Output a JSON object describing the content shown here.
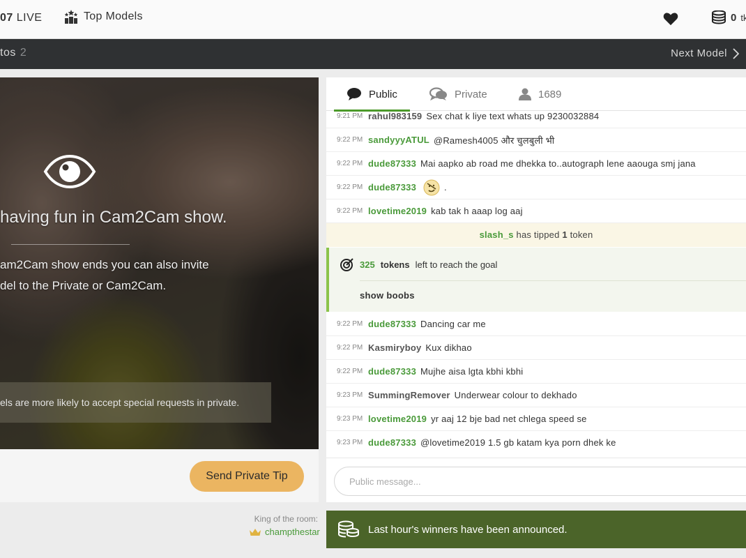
{
  "header": {
    "live_count_partial": "07",
    "live_label": "LIVE",
    "top_models_label": "Top Models",
    "token_count": "0",
    "token_label_partial": "tk"
  },
  "subbar": {
    "photos_label_partial": "tos",
    "photos_count": "2",
    "next_model_label": "Next Model"
  },
  "video": {
    "headline": "having fun in Cam2Cam show.",
    "line1": "am2Cam show ends you can also invite",
    "line2": "del to the Private or Cam2Cam.",
    "hint": "els are more likely to accept special requests in private.",
    "tip_button_label": "Send Private Tip"
  },
  "king": {
    "label": "King of the room:",
    "name": "champthestar"
  },
  "chat": {
    "tabs": {
      "public": "Public",
      "private": "Private",
      "users_count": "1689"
    },
    "messages": [
      {
        "time": "9:21 PM",
        "user": "rahul983159",
        "text": "Sex chat k liye text whats up 9230032884",
        "user_color": "grey"
      },
      {
        "time": "9:22 PM",
        "user": "sandyyyATUL",
        "text": "@Ramesh4005  और चुलबुली भी",
        "user_color": "green"
      },
      {
        "time": "9:22 PM",
        "user": "dude87333",
        "text": "Mai aapko ab road me dhekka to..autograph lene aaouga smj jana",
        "user_color": "green"
      },
      {
        "time": "9:22 PM",
        "user": "dude87333",
        "text": ".",
        "user_color": "green",
        "emoji": "smiley-icon"
      },
      {
        "time": "9:22 PM",
        "user": "lovetime2019",
        "text": "kab tak h aaap log aaj",
        "user_color": "green"
      }
    ],
    "tip_notice": {
      "user": "slash_s",
      "mid": "has tipped",
      "amount": "1",
      "unit": "token"
    },
    "goal": {
      "tokens": "325",
      "tokens_word": "tokens",
      "suffix": "left to reach the goal",
      "goal_text": "show boobs"
    },
    "messages2": [
      {
        "time": "9:22 PM",
        "user": "dude87333",
        "text": "Dancing car me",
        "user_color": "green"
      },
      {
        "time": "9:22 PM",
        "user": "Kasmiryboy",
        "text": "Kux dikhao",
        "user_color": "grey"
      },
      {
        "time": "9:22 PM",
        "user": "dude87333",
        "text": "Mujhe aisa lgta kbhi kbhi",
        "user_color": "green"
      },
      {
        "time": "9:23 PM",
        "user": "SummingRemover",
        "text": "Underwear colour to dekhado",
        "user_color": "grey"
      },
      {
        "time": "9:23 PM",
        "user": "lovetime2019",
        "text": "yr aaj 12 bje bad net chlega speed se",
        "user_color": "green"
      },
      {
        "time": "9:23 PM",
        "user": "dude87333",
        "text": " @lovetime2019  1.5 gb katam kya porn dhek ke",
        "user_color": "green"
      }
    ],
    "input_placeholder": "Public message..."
  },
  "winners_banner": "Last hour's winners have been announced.",
  "colors": {
    "accent_green": "#4c9a2a",
    "tip_button": "#ebb561",
    "banner_green": "#4b6429"
  }
}
